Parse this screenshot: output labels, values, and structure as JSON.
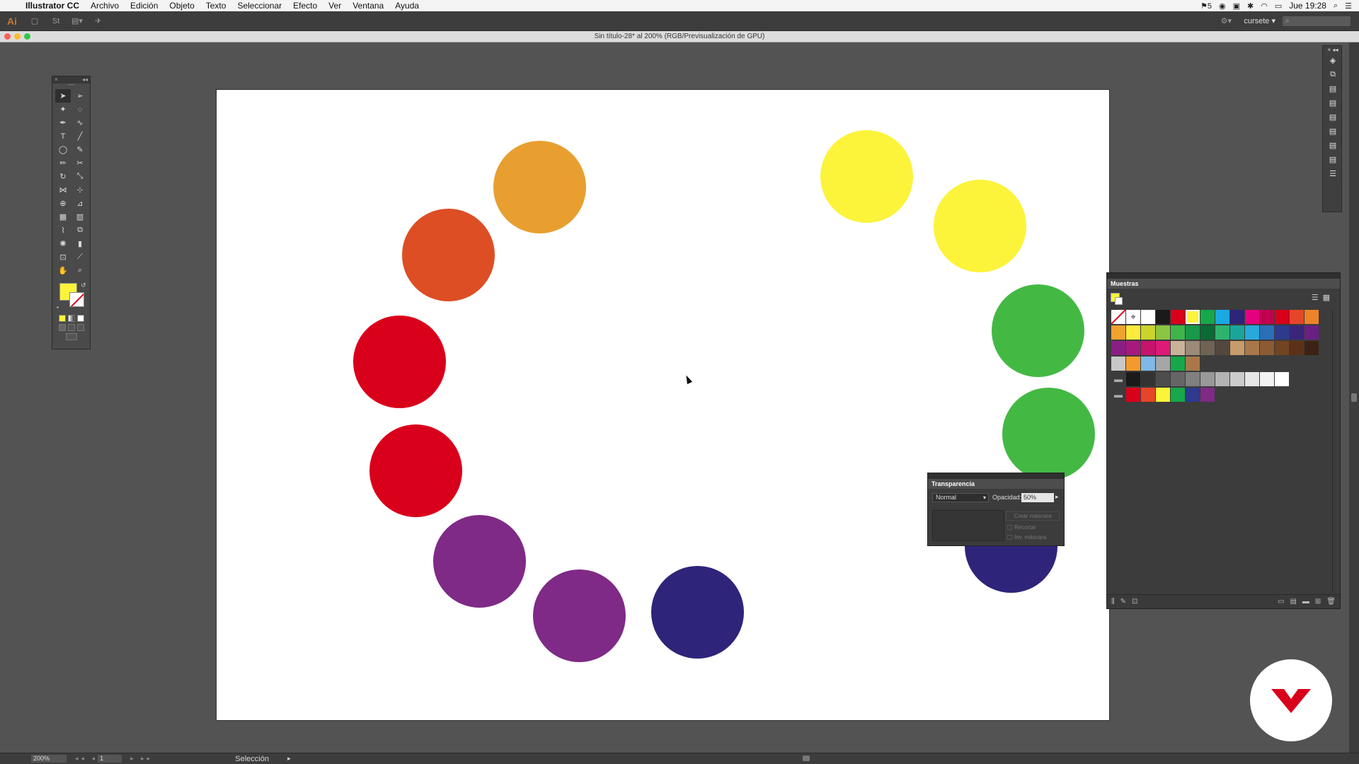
{
  "menubar": {
    "app_name": "Illustrator CC",
    "items": [
      "Archivo",
      "Edición",
      "Objeto",
      "Texto",
      "Seleccionar",
      "Efecto",
      "Ver",
      "Ventana",
      "Ayuda"
    ],
    "status_num": "5",
    "clock": "Jue 19:28"
  },
  "appbar": {
    "logo": "Ai",
    "workspace": "cursete"
  },
  "document": {
    "title": "Sin título-28* al 200% (RGB/Previsualización de GPU)"
  },
  "artboard": {
    "circles": [
      {
        "name": "circle-yellow-top",
        "color": "#fcf33b"
      },
      {
        "name": "circle-yellow-right",
        "color": "#fcf33b"
      },
      {
        "name": "circle-green-upper",
        "color": "#43b944"
      },
      {
        "name": "circle-green-lower",
        "color": "#43b944"
      },
      {
        "name": "circle-indigo-right",
        "color": "#2e2479"
      },
      {
        "name": "circle-indigo-bottom",
        "color": "#2e2479"
      },
      {
        "name": "circle-purple-bottom",
        "color": "#7e2a86"
      },
      {
        "name": "circle-purple-left",
        "color": "#7e2a86"
      },
      {
        "name": "circle-red-lower",
        "color": "#d9001b"
      },
      {
        "name": "circle-red-upper",
        "color": "#d9001b"
      },
      {
        "name": "circle-orange-red",
        "color": "#dd4e24"
      },
      {
        "name": "circle-orange",
        "color": "#e89f30"
      }
    ]
  },
  "toolbox": {
    "fill_color": "#fcf33b",
    "stroke_color": "none",
    "tools": [
      "selection-tool",
      "direct-selection-tool",
      "magic-wand-tool",
      "lasso-tool",
      "pen-tool",
      "curvature-tool",
      "type-tool",
      "line-tool",
      "ellipse-tool",
      "paintbrush-tool",
      "pencil-tool",
      "eraser-tool",
      "rotate-tool",
      "scale-tool",
      "width-tool",
      "free-transform-tool",
      "shape-builder-tool",
      "perspective-grid-tool",
      "mesh-tool",
      "gradient-tool",
      "eyedropper-tool",
      "blend-tool",
      "symbol-sprayer-tool",
      "column-graph-tool",
      "artboard-tool",
      "slice-tool",
      "hand-tool",
      "zoom-tool"
    ]
  },
  "swatches_panel": {
    "title": "Muestras",
    "rows": [
      [
        "none",
        "registration",
        "#ffffff",
        "#1a1a1a",
        "#d9001b",
        "#fcf33b",
        "#16a84a",
        "#1aa9e0",
        "#2e2479",
        "#e4007f",
        "#c0004f",
        "#d9001b",
        "#e5462a",
        "#ee8228"
      ],
      [
        "#f0a22e",
        "#fcea3c",
        "#cbd42c",
        "#8cc541",
        "#3fb549",
        "#19984a",
        "#0a6b34",
        "#2fb36f",
        "#1ba59a",
        "#29a9d9",
        "#2b6fb8",
        "#2e3a8d",
        "#3a2679",
        "#6a1f83"
      ],
      [
        "#8a1f83",
        "#a8197d",
        "#c4146c",
        "#de1a78",
        "#c9b398",
        "#9a8a78",
        "#6f6354",
        "#52483e",
        "#c89c6a",
        "#a9784a",
        "#8b5b34",
        "#734421",
        "#5b3217",
        "#3c2214"
      ],
      [
        "#c8c8c8",
        "#f39a2e",
        "#7fb9e6",
        "#a6a6a6",
        "#16a84a",
        "#a9784a"
      ],
      [
        "folder",
        "#1a1a1a",
        "#333333",
        "#4d4d4d",
        "#666666",
        "#808080",
        "#999999",
        "#b3b3b3",
        "#cccccc",
        "#e6e6e6",
        "#f2f2f2",
        "#ffffff"
      ],
      [
        "folder",
        "#d9001b",
        "#e5462a",
        "#fcf33b",
        "#16a84a",
        "#2e3a8d",
        "#7e2a86"
      ]
    ],
    "selected_color": "#fcf33b"
  },
  "transparency_panel": {
    "title": "Transparencia",
    "blend_mode": "Normal",
    "opacity_label": "Opacidad:",
    "opacity_value": "50%",
    "make_mask": "Crear máscara",
    "clip": "Recortar",
    "invert_mask": "Inv. máscara"
  },
  "statusbar": {
    "zoom": "200%",
    "page": "1",
    "current_tool": "Selección"
  }
}
